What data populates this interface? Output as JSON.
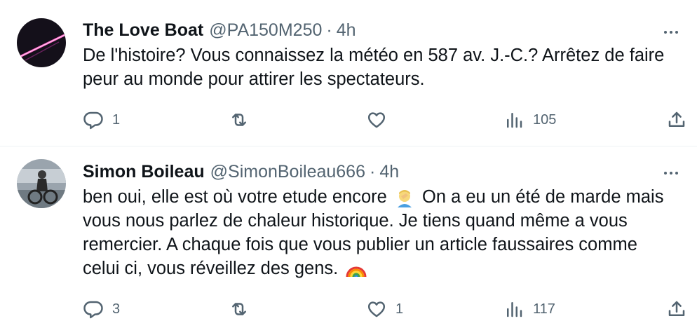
{
  "colors": {
    "text": "#0f1419",
    "muted": "#536471",
    "divider": "#eff3f4"
  },
  "tweets": [
    {
      "name": "The Love Boat",
      "handle": "@PA150M250",
      "separator": "·",
      "time": "4h",
      "lines": [
        "De l'histoire? Vous connaissez la météo en 587 av. J.-C.? Arrêtez de faire",
        "peur au monde pour attirer les spectateurs."
      ],
      "replies": "1",
      "retweets": "",
      "likes": "",
      "views": "105"
    },
    {
      "name": "Simon Boileau",
      "handle": "@SimonBoileau666",
      "separator": "·",
      "time": "4h",
      "line1_a": "ben oui, elle est où votre etude encore",
      "line1_b": "On a eu un été de marde mais",
      "lines": [
        "vous nous parlez de chaleur historique. Je tiens quand même a vous",
        "remercier. A chaque fois que vous publier un article faussaires comme"
      ],
      "line4": "celui ci, vous réveillez des gens.",
      "replies": "3",
      "retweets": "",
      "likes": "1",
      "views": "117"
    }
  ],
  "icons": {
    "reply": "reply-icon",
    "retweet": "retweet-icon",
    "like": "heart-icon",
    "views": "views-icon",
    "share": "share-icon",
    "more": "more-icon",
    "emoji_person": "person-facepalming-emoji",
    "emoji_rainbow": "rainbow-emoji"
  }
}
